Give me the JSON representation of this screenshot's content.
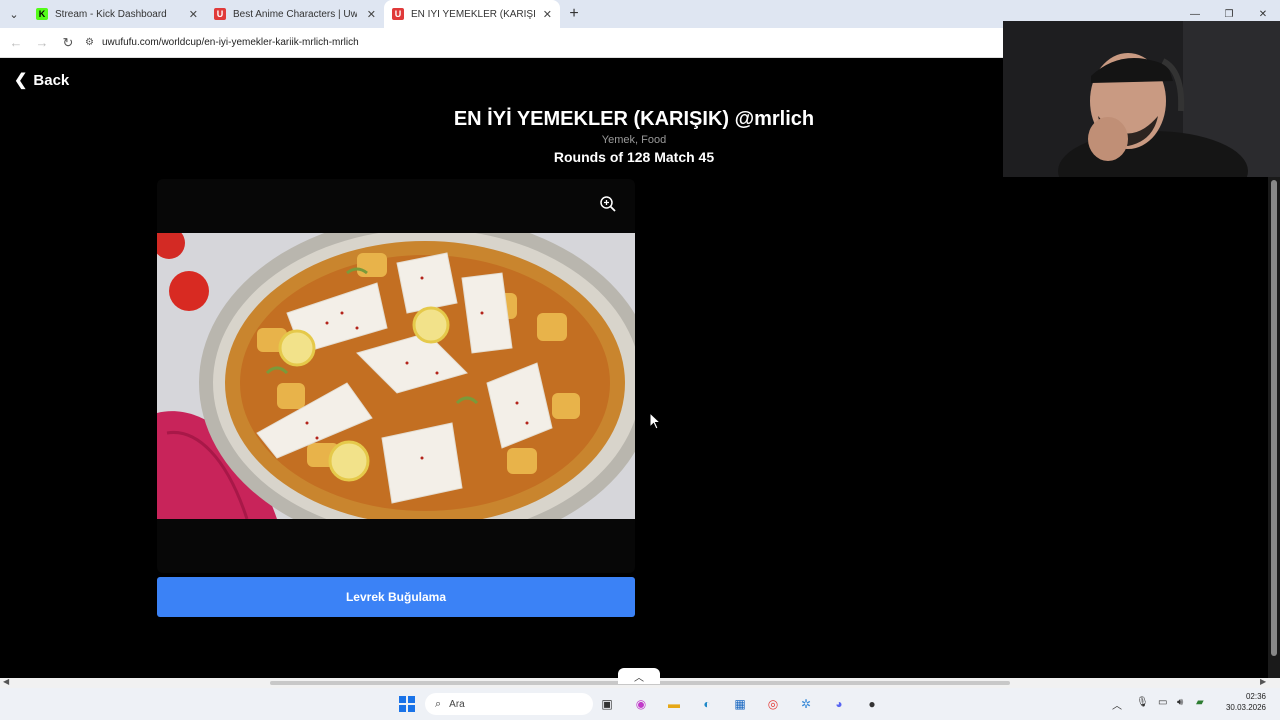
{
  "browser": {
    "tabs": [
      {
        "label": "Stream - Kick Dashboard",
        "favicon": "K",
        "favicon_color": "#53fc18",
        "active": false
      },
      {
        "label": "Best Anime Characters | UwUFU",
        "favicon": "U",
        "favicon_color": "#e03a3a",
        "active": false
      },
      {
        "label": "EN İYİ YEMEKLER (KARIŞIK) @m",
        "favicon": "U",
        "favicon_color": "#e03a3a",
        "active": true
      }
    ],
    "url": "uwufufu.com/worldcup/en-iyi-yemekler-kariik-mrlich-mrlich"
  },
  "page": {
    "back_label": "Back",
    "title": "EN İYİ YEMEKLER (KARIŞIK) @mrlich",
    "tags": "Yemek, Food",
    "round_info": "Rounds of 128 Match 45",
    "choice_label": "Levrek Buğulama"
  },
  "taskbar": {
    "search_placeholder": "Ara",
    "time": "02:36",
    "date": "30.03.2026",
    "icons": [
      "windows-start-icon",
      "search-icon",
      "task-view-icon",
      "copilot-icon",
      "file-explorer-icon",
      "edge-icon",
      "store-icon",
      "chrome-icon",
      "settings-icon",
      "discord-icon",
      "app-icon"
    ]
  },
  "colors": {
    "accent": "#3b82f6",
    "page_bg": "#000000",
    "tab_bg": "#dfe6f2"
  }
}
